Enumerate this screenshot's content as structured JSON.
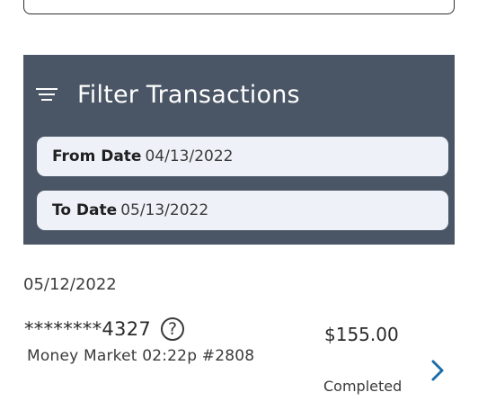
{
  "filter": {
    "title": "Filter Transactions",
    "from_label": "From Date",
    "from_value": "04/13/2022",
    "to_label": "To Date",
    "to_value": "05/13/2022"
  },
  "transactions": {
    "group_date": "05/12/2022",
    "items": [
      {
        "account": "********4327",
        "help_glyph": "?",
        "description": "Money Market 02:22p #2808",
        "amount": "$155.00",
        "status": "Completed"
      }
    ]
  },
  "icons": {
    "filter": "filter-lines-icon",
    "help": "question-circle-icon",
    "chevron": "chevron-right-icon"
  },
  "colors": {
    "panel_bg": "#4a5565",
    "field_bg": "#eef2f8",
    "chevron": "#1a6ea8"
  }
}
